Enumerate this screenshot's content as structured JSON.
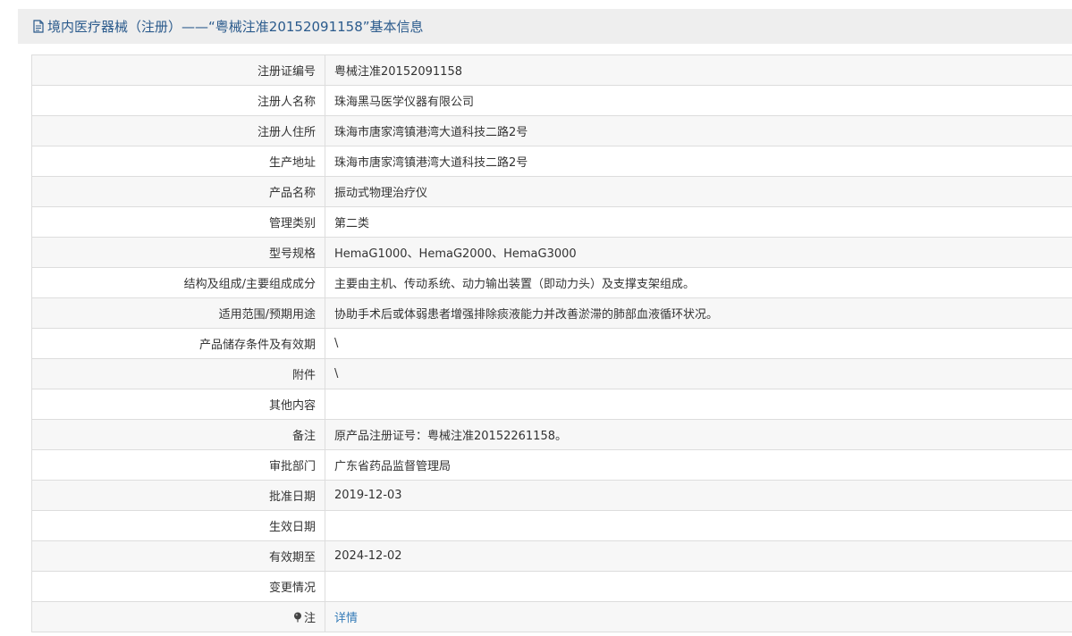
{
  "title": {
    "text": "境内医疗器械（注册）——“粤械注准20152091158”基本信息"
  },
  "rows": [
    {
      "label": "注册证编号",
      "value": "粤械注准20152091158"
    },
    {
      "label": "注册人名称",
      "value": "珠海黑马医学仪器有限公司"
    },
    {
      "label": "注册人住所",
      "value": "珠海市唐家湾镇港湾大道科技二路2号"
    },
    {
      "label": "生产地址",
      "value": "珠海市唐家湾镇港湾大道科技二路2号"
    },
    {
      "label": "产品名称",
      "value": "振动式物理治疗仪"
    },
    {
      "label": "管理类别",
      "value": "第二类"
    },
    {
      "label": "型号规格",
      "value": "HemaG1000、HemaG2000、HemaG3000"
    },
    {
      "label": "结构及组成/主要组成成分",
      "value": "主要由主机、传动系统、动力输出装置（即动力头）及支撑支架组成。"
    },
    {
      "label": "适用范围/预期用途",
      "value": "协助手术后或体弱患者增强排除痰液能力并改善淤滞的肺部血液循环状况。"
    },
    {
      "label": "产品储存条件及有效期",
      "value": "\\"
    },
    {
      "label": "附件",
      "value": "\\"
    },
    {
      "label": "其他内容",
      "value": ""
    },
    {
      "label": "备注",
      "value": "原产品注册证号：粤械注准20152261158。"
    },
    {
      "label": "审批部门",
      "value": "广东省药品监督管理局"
    },
    {
      "label": "批准日期",
      "value": "2019-12-03"
    },
    {
      "label": "生效日期",
      "value": ""
    },
    {
      "label": "有效期至",
      "value": "2024-12-02"
    },
    {
      "label": "变更情况",
      "value": ""
    }
  ],
  "note_row": {
    "label": "注",
    "icon": "pin-icon",
    "link_text": "详情"
  },
  "colors": {
    "title_text": "#2a5a8c",
    "title_bg": "#eeeeee",
    "row_odd": "#f7f7f7",
    "row_even": "#ffffff",
    "border": "#dddddd",
    "link": "#337ab7"
  }
}
